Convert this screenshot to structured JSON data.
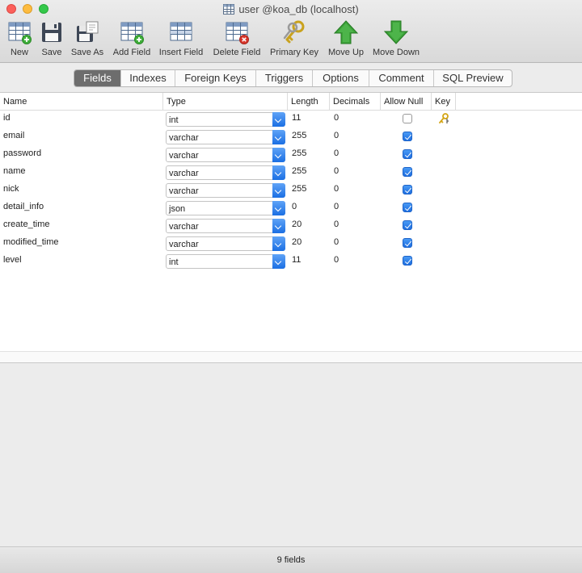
{
  "window": {
    "title": "user @koa_db (localhost)"
  },
  "toolbar": {
    "new": "New",
    "save": "Save",
    "save_as": "Save As",
    "add_field": "Add Field",
    "insert_field": "Insert Field",
    "delete_field": "Delete Field",
    "primary_key": "Primary Key",
    "move_up": "Move Up",
    "move_down": "Move Down"
  },
  "tabs": [
    "Fields",
    "Indexes",
    "Foreign Keys",
    "Triggers",
    "Options",
    "Comment",
    "SQL Preview"
  ],
  "active_tab": "Fields",
  "table": {
    "headers": {
      "name": "Name",
      "type": "Type",
      "length": "Length",
      "decimals": "Decimals",
      "allow_null": "Allow Null",
      "key": "Key"
    },
    "rows": [
      {
        "name": "id",
        "type": "int",
        "length": "11",
        "decimals": "0",
        "allow_null": false,
        "key": true
      },
      {
        "name": "email",
        "type": "varchar",
        "length": "255",
        "decimals": "0",
        "allow_null": true,
        "key": false
      },
      {
        "name": "password",
        "type": "varchar",
        "length": "255",
        "decimals": "0",
        "allow_null": true,
        "key": false
      },
      {
        "name": "name",
        "type": "varchar",
        "length": "255",
        "decimals": "0",
        "allow_null": true,
        "key": false
      },
      {
        "name": "nick",
        "type": "varchar",
        "length": "255",
        "decimals": "0",
        "allow_null": true,
        "key": false
      },
      {
        "name": "detail_info",
        "type": "json",
        "length": "0",
        "decimals": "0",
        "allow_null": true,
        "key": false
      },
      {
        "name": "create_time",
        "type": "varchar",
        "length": "20",
        "decimals": "0",
        "allow_null": true,
        "key": false
      },
      {
        "name": "modified_time",
        "type": "varchar",
        "length": "20",
        "decimals": "0",
        "allow_null": true,
        "key": false
      },
      {
        "name": "level",
        "type": "int",
        "length": "11",
        "decimals": "0",
        "allow_null": true,
        "key": false
      }
    ]
  },
  "status": {
    "text": "9 fields"
  },
  "colors": {
    "accent": "#1b6fe3",
    "tab_active": "#6d6d6d",
    "arrow_green": "#3da33a"
  }
}
